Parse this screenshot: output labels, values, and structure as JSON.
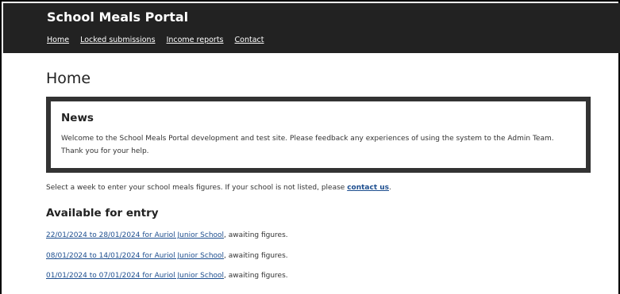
{
  "header": {
    "site_title": "School Meals Portal",
    "nav": [
      {
        "label": "Home"
      },
      {
        "label": "Locked submissions"
      },
      {
        "label": "Income reports"
      },
      {
        "label": "Contact"
      }
    ]
  },
  "main": {
    "page_title": "Home",
    "news": {
      "heading": "News",
      "body": "Welcome to the School Meals Portal development and test site. Please feedback any experiences of using the system to the Admin Team. Thank you for your help."
    },
    "intro": {
      "text_before": "Select a week to enter your school meals figures. If your school is not listed, please ",
      "link": "contact us",
      "text_after": "."
    },
    "available_heading": "Available for entry",
    "entries": [
      {
        "link": "22/01/2024 to 28/01/2024 for Auriol Junior School",
        "status": ", awaiting figures."
      },
      {
        "link": "08/01/2024 to 14/01/2024 for Auriol Junior School",
        "status": ", awaiting figures."
      },
      {
        "link": "01/01/2024 to 07/01/2024 for Auriol Junior School",
        "status": ", awaiting figures."
      }
    ]
  },
  "colors": {
    "header_bg": "#222222",
    "link": "#1d4e8f",
    "news_border": "#333333"
  }
}
